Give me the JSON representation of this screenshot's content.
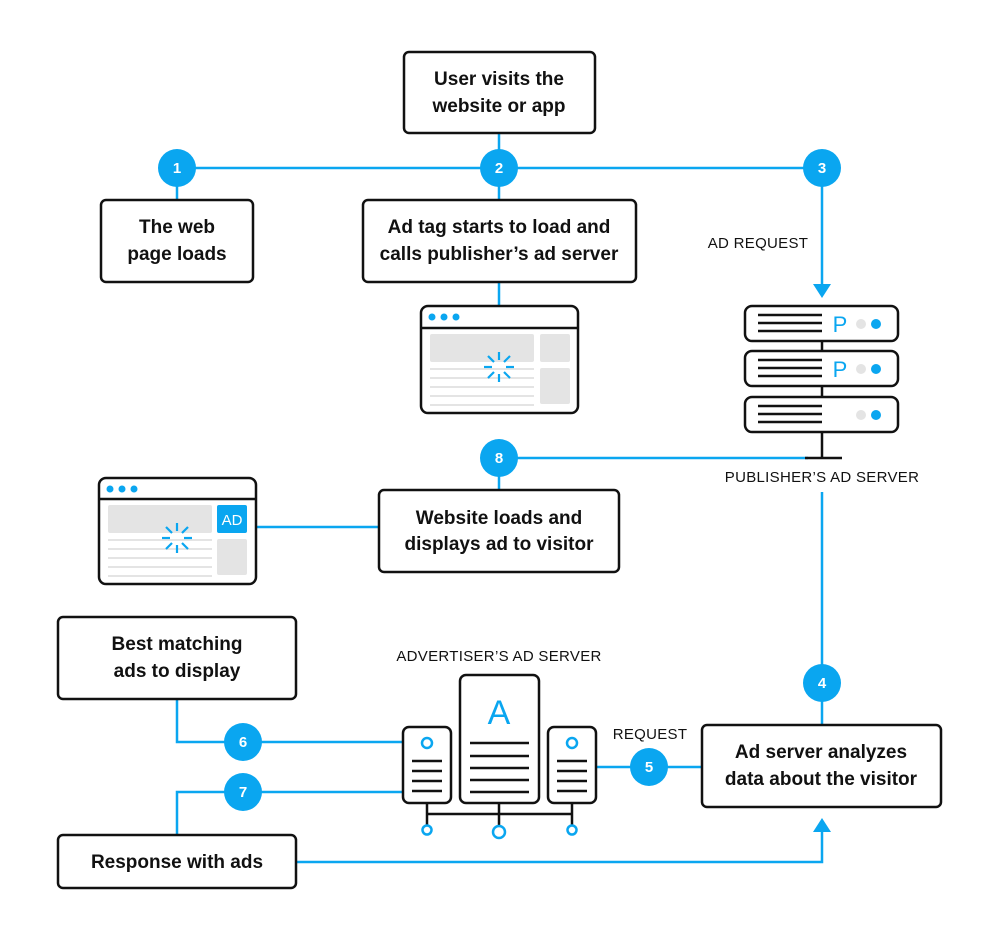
{
  "colors": {
    "accent": "#0aa6f0",
    "stroke": "#111111",
    "placeholder": "#e4e4e4"
  },
  "boxes": {
    "user_visits": [
      "User visits the",
      "website or app"
    ],
    "web_page_loads": [
      "The web",
      "page loads"
    ],
    "ad_tag": [
      "Ad tag starts to load and",
      "calls publisher’s ad server"
    ],
    "website_displays": [
      "Website loads and",
      "displays ad to visitor"
    ],
    "best_matching": [
      "Best matching",
      "ads to display"
    ],
    "response": [
      "Response with ads"
    ],
    "analyzes": [
      "Ad server analyzes",
      "data about the visitor"
    ]
  },
  "steps": [
    "1",
    "2",
    "3",
    "4",
    "5",
    "6",
    "7",
    "8"
  ],
  "labels": {
    "ad_request": "AD REQUEST",
    "publisher_server": "PUBLISHER’S AD SERVER",
    "advertiser_server": "ADVERTISER’S AD SERVER",
    "request": "REQUEST",
    "ad_badge": "AD",
    "publisher_letter": "P",
    "advertiser_letter": "A"
  }
}
